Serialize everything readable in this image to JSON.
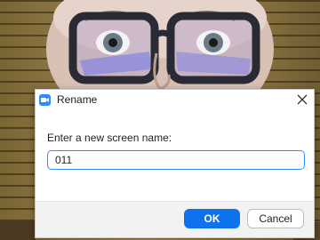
{
  "dialog": {
    "title": "Rename",
    "app_icon": "zoom-camera-icon",
    "close_icon": "close-icon",
    "prompt": "Enter a new screen name:",
    "input_value": "011",
    "ok_label": "OK",
    "cancel_label": "Cancel"
  },
  "colors": {
    "accent": "#0e72ed",
    "input_border": "#2d8cff"
  }
}
